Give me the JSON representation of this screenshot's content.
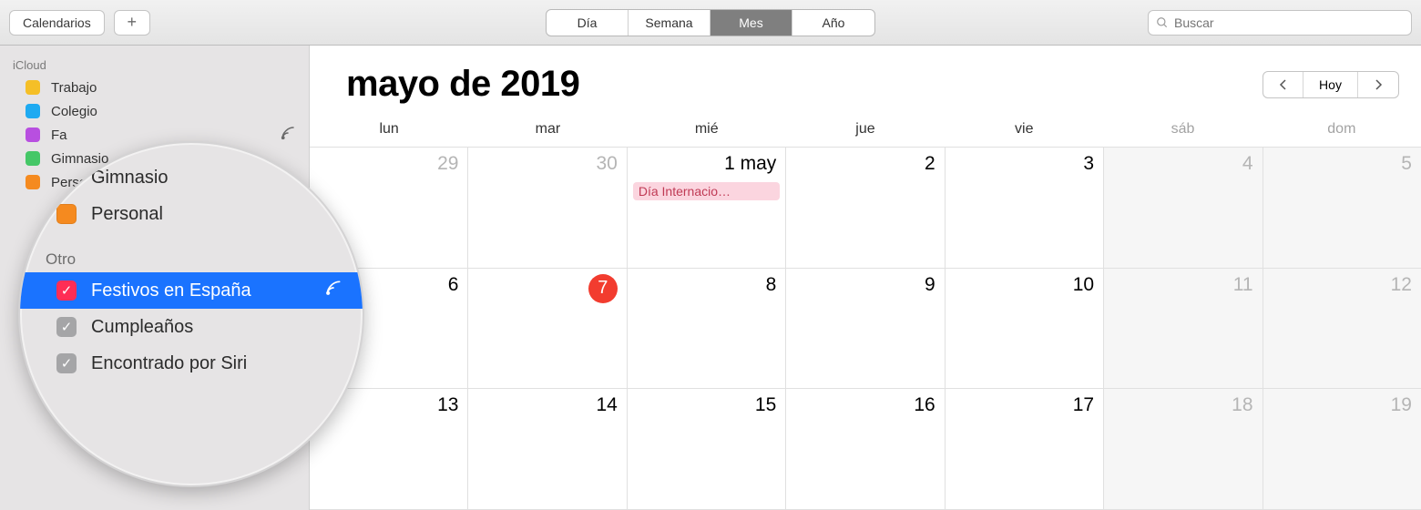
{
  "toolbar": {
    "calendars_btn": "Calendarios",
    "add_btn": "+",
    "views": [
      "Día",
      "Semana",
      "Mes",
      "Año"
    ],
    "view_selected": 2,
    "search_placeholder": "Buscar"
  },
  "sidebar": {
    "section1": "iCloud",
    "items": [
      {
        "label": "Trabajo",
        "color": "#f5bf27"
      },
      {
        "label": "Colegio",
        "color": "#1eaaf1"
      },
      {
        "label": "Fa",
        "color": "#b84fe0",
        "shared": true
      },
      {
        "label": "Gimnasio",
        "color": "#45c767"
      },
      {
        "label": "Personal",
        "color": "#f58a1f"
      }
    ]
  },
  "loupe": {
    "top_rows": [
      {
        "label": "Gimnasio",
        "color": "#45c767"
      },
      {
        "label": "Personal",
        "color": "#f58a1f"
      }
    ],
    "section": "Otro",
    "rows": [
      {
        "label": "Festivos en España",
        "check": "pink",
        "selected": true,
        "shared": true
      },
      {
        "label": "Cumpleaños",
        "check": "gray"
      },
      {
        "label": "Encontrado por Siri",
        "check": "gray"
      }
    ]
  },
  "month": {
    "title": "mayo de 2019",
    "today_btn": "Hoy",
    "weekdays": [
      "lun",
      "mar",
      "mié",
      "jue",
      "vie",
      "sáb",
      "dom"
    ],
    "rows": [
      [
        {
          "n": "29",
          "prev": true
        },
        {
          "n": "30",
          "prev": true
        },
        {
          "n": "1 may",
          "event": "Día Internacio…"
        },
        {
          "n": "2"
        },
        {
          "n": "3"
        },
        {
          "n": "4",
          "weekend": true
        },
        {
          "n": "5",
          "weekend": true
        }
      ],
      [
        {
          "n": "6"
        },
        {
          "n": "7",
          "today": true
        },
        {
          "n": "8"
        },
        {
          "n": "9"
        },
        {
          "n": "10"
        },
        {
          "n": "11",
          "weekend": true
        },
        {
          "n": "12",
          "weekend": true
        }
      ],
      [
        {
          "n": "13"
        },
        {
          "n": "14"
        },
        {
          "n": "15"
        },
        {
          "n": "16"
        },
        {
          "n": "17"
        },
        {
          "n": "18",
          "weekend": true
        },
        {
          "n": "19",
          "weekend": true
        }
      ]
    ]
  },
  "colors": {
    "today": "#f23c2f",
    "event_bg": "#fbd5df",
    "selection": "#1a73ff"
  }
}
